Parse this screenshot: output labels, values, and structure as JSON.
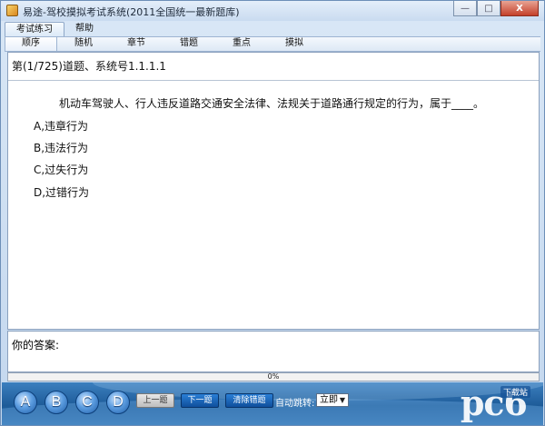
{
  "window": {
    "title": "易途-驾校摸拟考试系统(2011全国统一最新题库)",
    "controls": {
      "minimize": "—",
      "maximize": "□",
      "close": "X"
    }
  },
  "menu": {
    "items": [
      {
        "label": "考试练习",
        "active": true
      },
      {
        "label": "帮助",
        "active": false
      }
    ]
  },
  "subbar": {
    "items": [
      {
        "label": "顺序",
        "active": true
      },
      {
        "label": "随机",
        "active": false
      },
      {
        "label": "章节",
        "active": false
      },
      {
        "label": "错题",
        "active": false
      },
      {
        "label": "重点",
        "active": false
      },
      {
        "label": "摸拟",
        "active": false
      }
    ]
  },
  "question": {
    "number_line": "第(1/725)道题、系统号1.1.1.1",
    "text": "机动车驾驶人、行人违反道路交通安全法律、法规关于道路通行规定的行为，属于____。",
    "options": [
      "A,违章行为",
      "B,违法行为",
      "C,过失行为",
      "D,过错行为"
    ]
  },
  "answer": {
    "label": "你的答案:"
  },
  "progress": {
    "text": "0%",
    "value": 0
  },
  "controls": {
    "answer_buttons": [
      "A",
      "B",
      "C",
      "D"
    ],
    "prev_label": "上一题",
    "next_label": "下一题",
    "clear_label": "清除错题",
    "auto_jump_label": "自动跳转:",
    "auto_jump_value": "立即"
  },
  "logo": {
    "text": "pc6",
    "sub": "下载站"
  },
  "colors": {
    "accent": "#1d5b98",
    "progress": "#4b9be0"
  }
}
